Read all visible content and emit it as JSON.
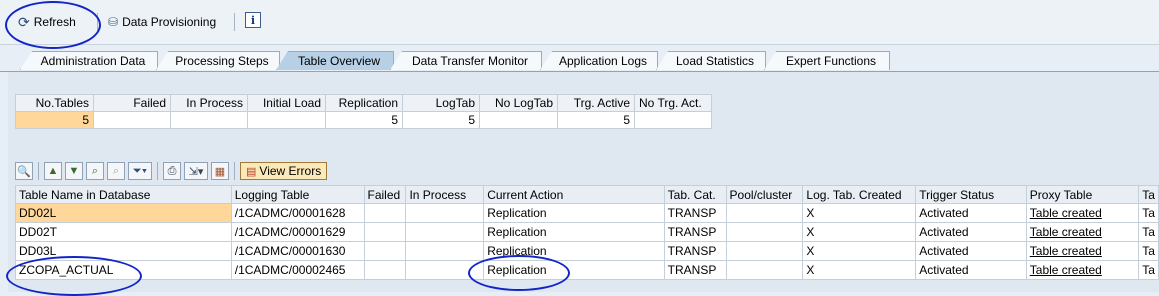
{
  "toolbar": {
    "refresh_label": "Refresh",
    "data_provisioning_label": "Data Provisioning",
    "info_glyph": "i"
  },
  "tabs": [
    {
      "label": "Administration Data"
    },
    {
      "label": "Processing Steps"
    },
    {
      "label": "Table Overview"
    },
    {
      "label": "Data Transfer Monitor"
    },
    {
      "label": "Application Logs"
    },
    {
      "label": "Load Statistics"
    },
    {
      "label": "Expert Functions"
    }
  ],
  "active_tab": "Table Overview",
  "summary": {
    "headers": [
      "No.Tables",
      "Failed",
      "In Process",
      "Initial Load",
      "Replication",
      "LogTab",
      "No LogTab",
      "Trg. Active",
      "No Trg. Act."
    ],
    "values": [
      "5",
      "",
      "",
      "",
      "5",
      "5",
      "",
      "5",
      ""
    ]
  },
  "view_errors_label": "View Errors",
  "grid": {
    "headers": [
      "Table Name in Database",
      "Logging Table",
      "Failed",
      "In Process",
      "Current Action",
      "Tab. Cat.",
      "Pool/cluster",
      "Log. Tab. Created",
      "Trigger Status",
      "Proxy Table",
      "Ta"
    ],
    "rows": [
      {
        "name": "DD02L",
        "logging": "/1CADMC/00001628",
        "failed": "",
        "inproc": "",
        "action": "Replication",
        "cat": "TRANSP",
        "pool": "",
        "logtab": "X",
        "trigger": "Activated",
        "proxy": "Table created",
        "ta": "Ta"
      },
      {
        "name": "DD02T",
        "logging": "/1CADMC/00001629",
        "failed": "",
        "inproc": "",
        "action": "Replication",
        "cat": "TRANSP",
        "pool": "",
        "logtab": "X",
        "trigger": "Activated",
        "proxy": "Table created",
        "ta": "Ta"
      },
      {
        "name": "DD03L",
        "logging": "/1CADMC/00001630",
        "failed": "",
        "inproc": "",
        "action": "Replication",
        "cat": "TRANSP",
        "pool": "",
        "logtab": "X",
        "trigger": "Activated",
        "proxy": "Table created",
        "ta": "Ta"
      },
      {
        "name": "ZCOPA_ACTUAL",
        "logging": "/1CADMC/00002465",
        "failed": "",
        "inproc": "",
        "action": "Replication",
        "cat": "TRANSP",
        "pool": "",
        "logtab": "X",
        "trigger": "Activated",
        "proxy": "Table created",
        "ta": "Ta"
      }
    ]
  },
  "colors": {
    "annotation": "#1226c8",
    "selected_cell": "#ffd79a",
    "active_tab": "#b7d0e6"
  }
}
